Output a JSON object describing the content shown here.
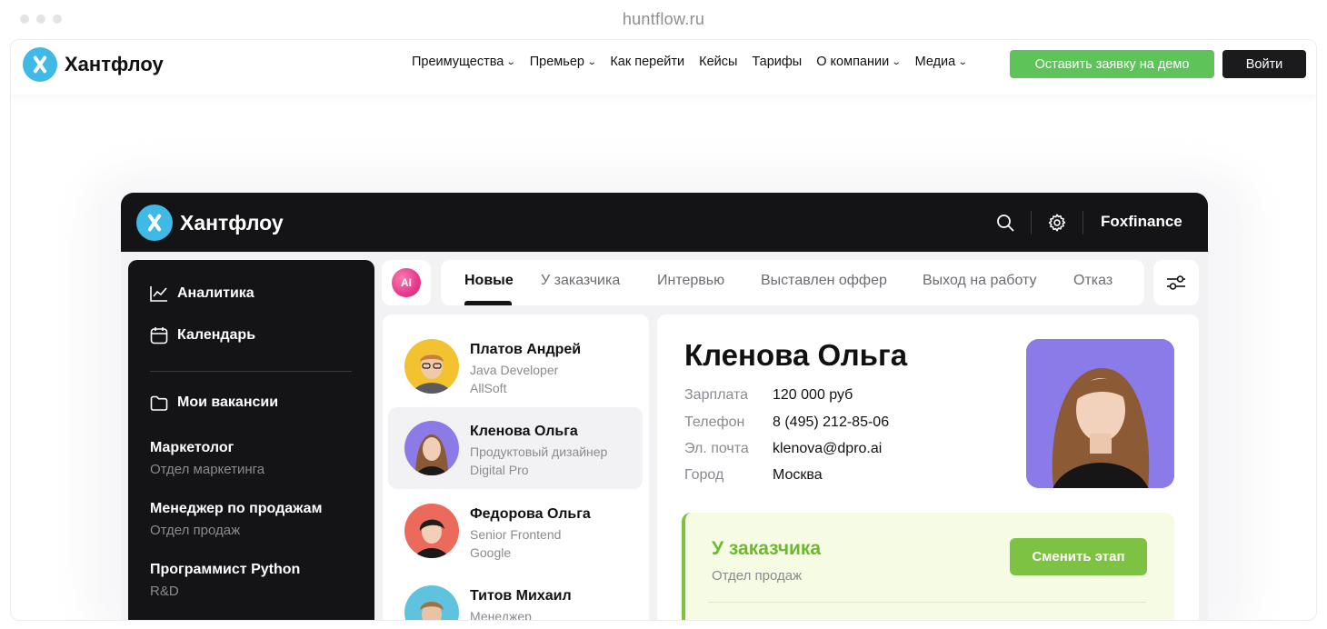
{
  "browser": {
    "url": "huntflow.ru"
  },
  "site": {
    "logo_text": "Хантфлоу",
    "nav": [
      {
        "label": "Преимущества",
        "dropdown": true
      },
      {
        "label": "Премьер",
        "dropdown": true
      },
      {
        "label": "Как перейти",
        "dropdown": false
      },
      {
        "label": "Кейсы",
        "dropdown": false
      },
      {
        "label": "Тарифы",
        "dropdown": false
      },
      {
        "label": "О компании",
        "dropdown": true
      },
      {
        "label": "Медиа",
        "dropdown": true
      }
    ],
    "demo_button": "Оставить заявку на демо",
    "login_button": "Войти",
    "colors": {
      "accent_green": "#5ec45a",
      "logo_blue": "#3fb9e6",
      "dark": "#1b1b1d"
    }
  },
  "app": {
    "logo_text": "Хантфлоу",
    "company": "Foxfinance",
    "sidebar": {
      "items": [
        {
          "label": "Аналитика",
          "icon": "chart-icon"
        },
        {
          "label": "Календарь",
          "icon": "calendar-icon"
        },
        {
          "label": "Мои вакансии",
          "icon": "folder-icon"
        }
      ],
      "vacancies": [
        {
          "title": "Маркетолог",
          "dept": "Отдел маркетинга"
        },
        {
          "title": "Менеджер по продажам",
          "dept": "Отдел продаж"
        },
        {
          "title": "Программист Python",
          "dept": "R&D"
        }
      ]
    },
    "ai_label": "AI",
    "tabs": [
      "Новые",
      "У заказчика",
      "Интервью",
      "Выставлен оффер",
      "Выход на работу",
      "Отказ"
    ],
    "active_tab": "Новые",
    "candidates": [
      {
        "name": "Платов Андрей",
        "role": "Java Developer",
        "company": "AllSoft"
      },
      {
        "name": "Кленова Ольга",
        "role": "Продуктовый дизайнер",
        "company": "Digital Pro"
      },
      {
        "name": "Федорова Ольга",
        "role": "Senior Frontend",
        "company": "Google"
      },
      {
        "name": "Титов Михаил",
        "role": "Менеджер",
        "company": ""
      }
    ],
    "detail": {
      "name": "Кленова Ольга",
      "fields": [
        {
          "label": "Зарплата",
          "value": "120 000 руб"
        },
        {
          "label": "Телефон",
          "value": "8 (495) 212-85-06"
        },
        {
          "label": "Эл. почта",
          "value": "klenova@dpro.ai"
        },
        {
          "label": "Город",
          "value": "Москва"
        }
      ],
      "stage": {
        "title": "У заказчика",
        "dept": "Отдел продаж",
        "button": "Сменить этап"
      }
    }
  }
}
